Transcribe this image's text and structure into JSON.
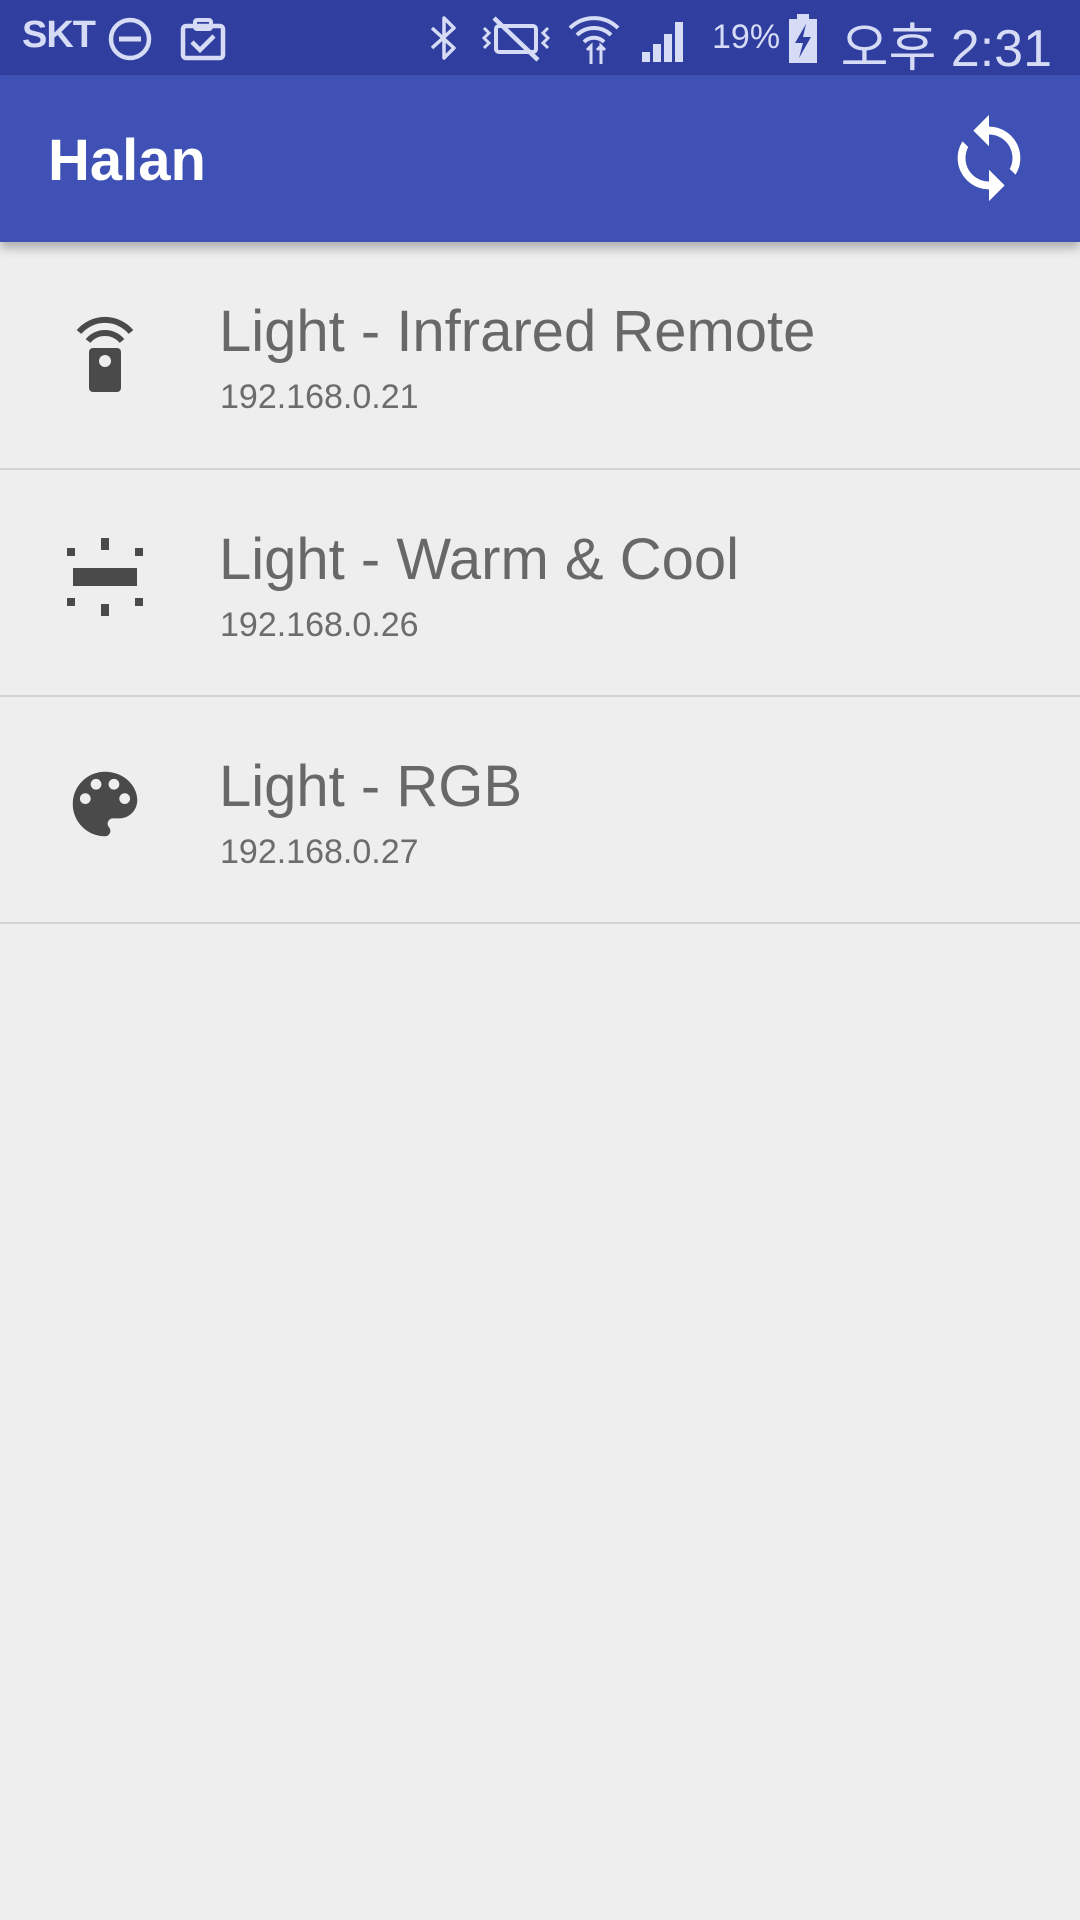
{
  "status_bar": {
    "carrier": "SKT",
    "battery_percent": "19%",
    "time": "오후 2:31",
    "icons": [
      "do-not-disturb-icon",
      "clipboard-check-icon",
      "bluetooth-icon",
      "vibrate-off-icon",
      "wifi-icon",
      "cell-signal-icon",
      "battery-charging-icon"
    ]
  },
  "app_bar": {
    "title": "Halan",
    "action_icon": "refresh-icon"
  },
  "devices": [
    {
      "name": "Light - Infrared Remote",
      "ip": "192.168.0.21",
      "icon": "remote-control-icon"
    },
    {
      "name": "Light - Warm & Cool",
      "ip": "192.168.0.26",
      "icon": "light-strip-icon"
    },
    {
      "name": "Light - RGB",
      "ip": "192.168.0.27",
      "icon": "palette-icon"
    }
  ],
  "colors": {
    "status_bar": "#303f9f",
    "app_bar": "#3f51b5",
    "background": "#eeeeee",
    "text_primary": "#686868",
    "icon": "#4a4a4a"
  }
}
